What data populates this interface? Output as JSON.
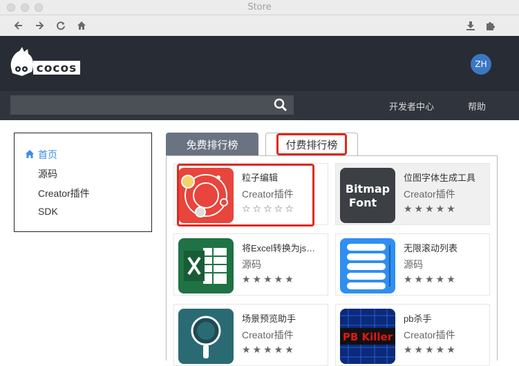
{
  "window": {
    "title": "Store"
  },
  "header": {
    "logo_text": "cocos",
    "avatar": "ZH"
  },
  "search": {
    "value": "",
    "placeholder": ""
  },
  "nav": {
    "developer_center": "开发者中心",
    "help": "帮助"
  },
  "sidebar": {
    "items": [
      {
        "label": "首页",
        "active": true
      },
      {
        "label": "源码"
      },
      {
        "label": "Creator插件"
      },
      {
        "label": "SDK"
      }
    ]
  },
  "tabs": [
    {
      "label": "免费排行榜",
      "selected": false
    },
    {
      "label": "付费排行榜",
      "selected": true
    }
  ],
  "cards": [
    {
      "name": "粒子编辑",
      "category": "Creator插件",
      "stars": "☆☆☆☆☆",
      "icon": "particle-editor-icon",
      "highlighted": true
    },
    {
      "name": "位图字体生成工具",
      "category": "Creator插件",
      "stars": "★★★★★",
      "icon": "bitmap-font-icon",
      "icon_text_1": "Bitmap",
      "icon_text_2": "Font"
    },
    {
      "name": "将Excel转换为js…",
      "category": "源码",
      "stars": "★★★★★",
      "icon": "excel-icon"
    },
    {
      "name": "无限滚动列表",
      "category": "源码",
      "stars": "★★★★★",
      "icon": "scroll-list-icon"
    },
    {
      "name": "场景预览助手",
      "category": "Creator插件",
      "stars": "★★★★★",
      "icon": "scene-preview-icon"
    },
    {
      "name": "pb杀手",
      "category": "Creator插件",
      "stars": "★★★★★",
      "icon": "pb-killer-icon",
      "icon_text": "PB Killer"
    }
  ],
  "colors": {
    "accent": "#3a8ee6",
    "highlight": "#e0281d",
    "header": "#282c34"
  }
}
